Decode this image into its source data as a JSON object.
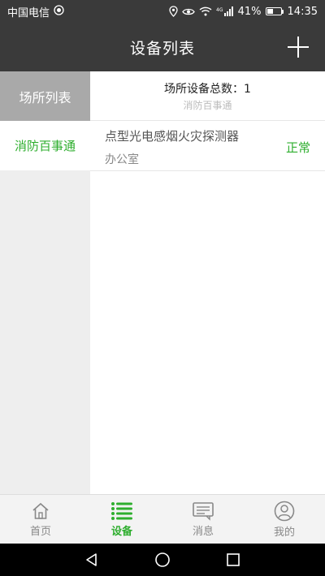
{
  "status_bar": {
    "carrier": "中国电信",
    "network": "4G",
    "battery": "41%",
    "battery_level": 0.41,
    "time": "14:35"
  },
  "header": {
    "title": "设备列表",
    "add_icon": "plus-icon"
  },
  "sidebar": {
    "header": "场所列表",
    "items": [
      {
        "label": "消防百事通"
      }
    ]
  },
  "main": {
    "summary_label": "场所设备总数：1",
    "summary_place": "消防百事通",
    "devices": [
      {
        "name": "点型光电感烟火灾探测器",
        "location": "办公室",
        "status": "正常"
      }
    ]
  },
  "tabs": [
    {
      "label": "首页",
      "icon": "home-icon",
      "active": false
    },
    {
      "label": "设备",
      "icon": "list-icon",
      "active": true
    },
    {
      "label": "消息",
      "icon": "message-icon",
      "active": false
    },
    {
      "label": "我的",
      "icon": "user-icon",
      "active": false
    }
  ],
  "colors": {
    "header_bg": "#3a3a3a",
    "accent_green": "#2eae2e",
    "sidebar_header_bg": "#a9a9a9",
    "sidebar_bg": "#eeeeee"
  },
  "nav": {
    "back_icon": "back-icon",
    "home_icon": "home-circle-icon",
    "recents_icon": "recents-icon"
  }
}
